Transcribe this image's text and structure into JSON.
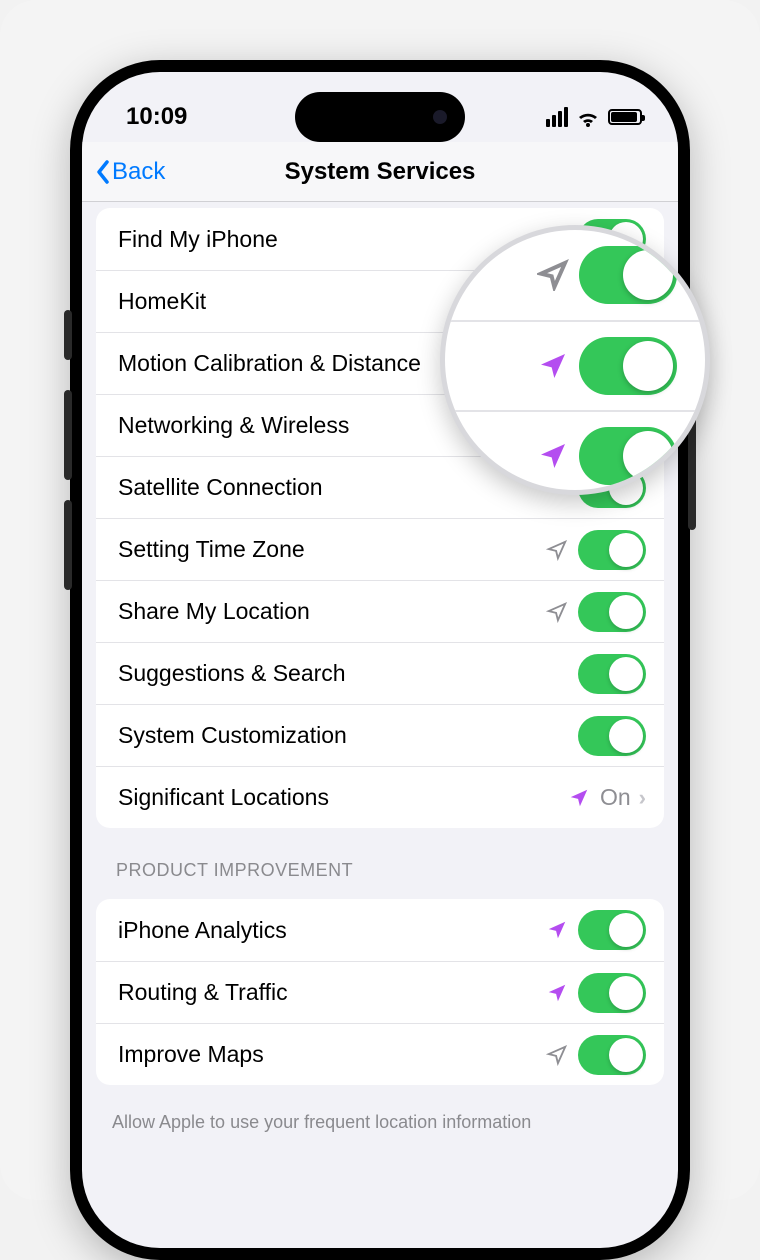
{
  "status": {
    "time": "10:09"
  },
  "nav": {
    "back": "Back",
    "title": "System Services"
  },
  "group1": [
    {
      "label": "Find My iPhone",
      "indicator": "purple",
      "toggle": true
    },
    {
      "label": "HomeKit",
      "indicator": "none",
      "toggle": true
    },
    {
      "label": "Motion Calibration & Distance",
      "indicator": "purple",
      "toggle": true
    },
    {
      "label": "Networking & Wireless",
      "indicator": "purple",
      "toggle": true
    },
    {
      "label": "Satellite Connection",
      "indicator": "none",
      "toggle": true
    },
    {
      "label": "Setting Time Zone",
      "indicator": "gray",
      "toggle": true
    },
    {
      "label": "Share My Location",
      "indicator": "gray",
      "toggle": true
    },
    {
      "label": "Suggestions & Search",
      "indicator": "none",
      "toggle": true
    },
    {
      "label": "System Customization",
      "indicator": "none",
      "toggle": true
    }
  ],
  "significant": {
    "label": "Significant Locations",
    "indicator": "purple",
    "value": "On"
  },
  "section2_header": "PRODUCT IMPROVEMENT",
  "group2": [
    {
      "label": "iPhone Analytics",
      "indicator": "purple",
      "toggle": true
    },
    {
      "label": "Routing & Traffic",
      "indicator": "purple",
      "toggle": true
    },
    {
      "label": "Improve Maps",
      "indicator": "gray",
      "toggle": true
    }
  ],
  "footer": "Allow Apple to use your frequent location information"
}
